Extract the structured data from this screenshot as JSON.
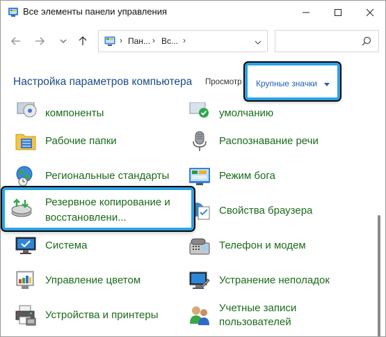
{
  "window": {
    "title": "Все элементы панели управления"
  },
  "address": {
    "segments": [
      "Пан...",
      "Вс..."
    ],
    "search_placeholder": ""
  },
  "header": {
    "title": "Настройка параметров компьютера",
    "view_label": "Просмотр",
    "view_value": "Крупные значки"
  },
  "items_left": [
    {
      "label": "компоненты",
      "icon": "programs-features-icon"
    },
    {
      "label": "Рабочие папки",
      "icon": "work-folders-icon"
    },
    {
      "label": "Региональные стандарты",
      "icon": "region-globe-icon"
    },
    {
      "label": "Резервное копирование и",
      "label2": "восстановлени...",
      "icon": "backup-restore-icon"
    },
    {
      "label": "Система",
      "icon": "system-monitor-icon"
    },
    {
      "label": "Управление цветом",
      "icon": "color-management-icon"
    },
    {
      "label": "Устройства и принтеры",
      "icon": "printer-icon"
    }
  ],
  "items_right": [
    {
      "label": "умолчанию",
      "icon": "default-programs-icon"
    },
    {
      "label": "Распознавание речи",
      "icon": "microphone-icon"
    },
    {
      "label": "Режим бога",
      "icon": "god-mode-icon"
    },
    {
      "label": "Свойства браузера",
      "icon": "internet-options-icon"
    },
    {
      "label": "Телефон и модем",
      "icon": "phone-modem-icon"
    },
    {
      "label": "Устранение неполадок",
      "icon": "troubleshooting-icon"
    },
    {
      "label": "Учетные записи",
      "label2": "пользователей",
      "icon": "user-accounts-icon"
    }
  ],
  "colors": {
    "accent": "#2aa2e8",
    "item_text": "#1a6b1a",
    "header_text": "#1a4a8a"
  }
}
